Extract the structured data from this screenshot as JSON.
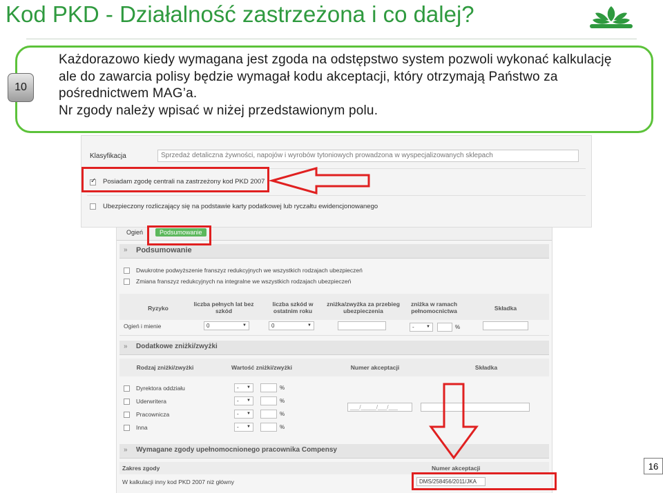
{
  "slide": {
    "title": "Kod PKD - Działalność zastrzeżona i co dalej?",
    "step_badge": "10",
    "page_number": "16",
    "callout_line1": "Każdorazowo kiedy wymagana jest zgoda na odstępstwo system pozwoli wykonać kalkulację",
    "callout_line2": "ale do zawarcia polisy będzie wymagał kodu akceptacji, który otrzymają Państwo za",
    "callout_line3": "pośrednictwem MAG’a.",
    "callout_line4": "Nr zgody należy wpisać w niżej przedstawionym polu.",
    "brand_color": "#2f9a3f",
    "highlight_color": "#e02020",
    "logo_icon": "leaf-logo-icon"
  },
  "panel1": {
    "klasyfikacja_label": "Klasyfikacja",
    "klasyfikacja_value": "Sprzedaż detaliczna żywności, napojów i wyrobów tytoniowych prowadzona w wyspecjalizowanych sklepach",
    "checkbox1_label": "Posiadam zgodę centrali na zastrzeżony kod PKD 2007",
    "checkbox1_checked": true,
    "checkbox2_label": "Ubezpieczony rozliczający się na podstawie karty podatkowej lub ryczałtu ewidencjonowanego",
    "checkbox2_checked": false
  },
  "panel2": {
    "tab_ogien": "Ogień",
    "tab_podsumowanie": "Podsumowanie",
    "section_podsumowanie": "Podsumowanie",
    "check_a": "Dwukrotne podwyższenie franszyz redukcyjnych we wszystkich rodzajach ubezpieczeń",
    "check_b": "Zmiana franszyz redukcyjnych na integralne we wszystkich rodzajach ubezpieczeń",
    "risk_headers": {
      "ryzyko": "Ryzyko",
      "lat_bez_szkod": "liczba pełnych lat bez szkód",
      "szkod_ostatnim": "liczba szkód w ostatnim roku",
      "znizka_przebieg": "zniżka/zwyżka za przebieg ubezpieczenia",
      "znizka_pelnomocnictwa": "zniżka w ramach pełnomocnictwa",
      "skladka": "Składka"
    },
    "risk_row": {
      "name": "Ogień i mienie",
      "lat_value": "0",
      "szkod_value": "0",
      "przebieg_value": "",
      "pelnomocnictwa_value": "-",
      "pct": "%",
      "skladka_value": ""
    },
    "section_dodatkowe": "Dodatkowe zniżki/zwyżki",
    "disc_headers": {
      "rodzaj": "Rodzaj zniżki/zwyżki",
      "wartosc": "Wartość zniżki/zwyżki",
      "numer": "Numer akceptacji",
      "skladka": "Składka"
    },
    "disc_rows": [
      {
        "name": "Dyrektora oddziału",
        "value": "-",
        "pct": "%"
      },
      {
        "name": "Uderwritera",
        "value": "-",
        "pct": "%"
      },
      {
        "name": "Pracownicza",
        "value": "-",
        "pct": "%"
      },
      {
        "name": "Inna",
        "value": "-",
        "pct": "%"
      }
    ],
    "numer_placeholder": "___/_____/___/___",
    "section_wymagane": "Wymagane zgody upełnomocnionego pracownika Compensy",
    "zakres_label": "Zakres zgody",
    "numer_akceptacji_label": "Numer akceptacji",
    "zgoda_row": "W kalkulacji inny kod PKD 2007 niż główny",
    "zgoda_value": "DMS/258456/2011/JKA"
  }
}
